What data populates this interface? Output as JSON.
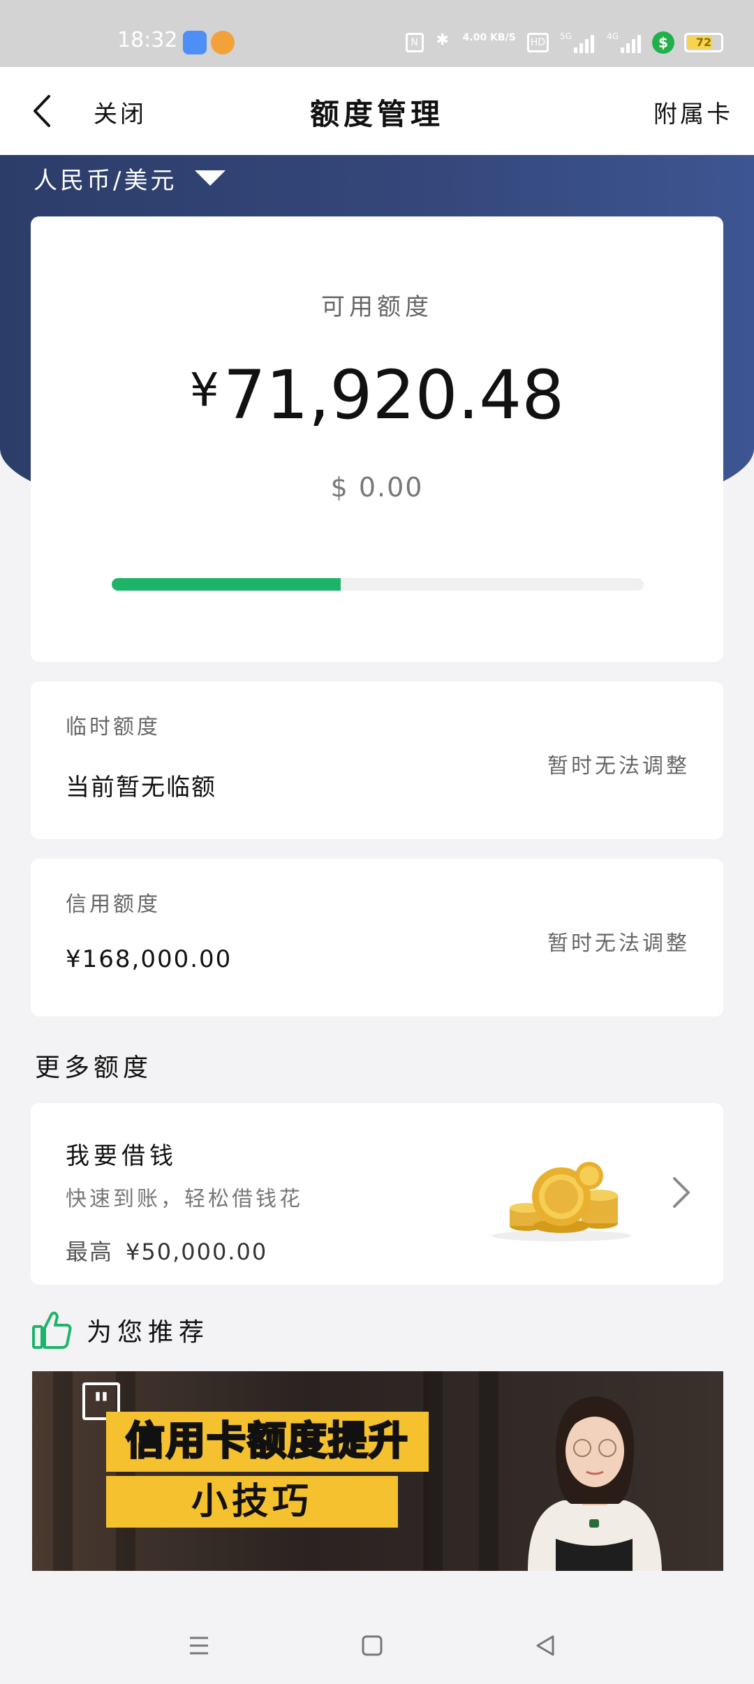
{
  "status_bar": {
    "time": "18:32",
    "network_speed": "4.00 KB/S",
    "hd_label": "HD",
    "signal1": "5G",
    "signal2": "4G",
    "battery": "72"
  },
  "nav": {
    "close_label": "关闭",
    "title": "额度管理",
    "right_label": "附属卡"
  },
  "currency_toggle": {
    "label": "人民币/美元"
  },
  "available": {
    "label": "可用额度",
    "symbol": "¥",
    "amount": "71,920.48",
    "usd": "$ 0.00",
    "progress_fraction": 0.43,
    "progress_color": "#1db46a"
  },
  "temporary": {
    "label": "临时额度",
    "value": "当前暂无临额",
    "note": "暂时无法调整"
  },
  "credit": {
    "label": "信用额度",
    "value": "¥168,000.00",
    "note": "暂时无法调整"
  },
  "more_section": {
    "title": "更多额度"
  },
  "loan": {
    "title": "我要借钱",
    "subtitle": "快速到账，轻松借钱花",
    "max_label": "最高",
    "max_value": "¥50,000.00"
  },
  "recommend": {
    "title": "为您推荐"
  },
  "banner": {
    "line1": "信用卡额度提升",
    "line2": "小技巧"
  },
  "colors": {
    "hero_blue": "#34477a",
    "accent_green": "#1db46a",
    "banner_yellow": "#f6c12e"
  }
}
